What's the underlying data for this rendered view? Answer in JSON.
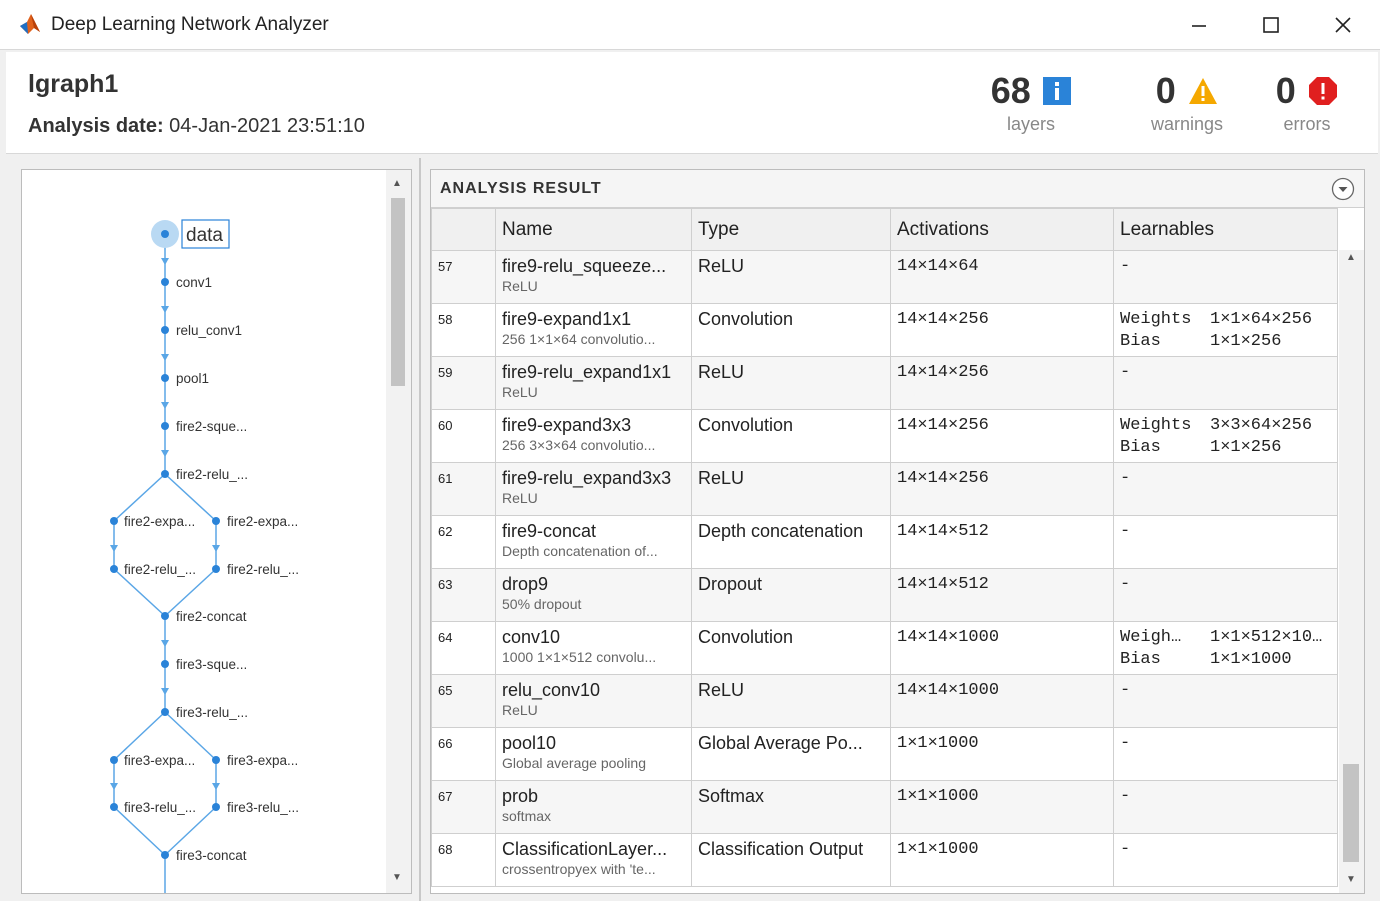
{
  "window": {
    "title": "Deep Learning Network Analyzer"
  },
  "header": {
    "graph_name": "lgraph1",
    "analysis_date_label": "Analysis date:",
    "analysis_date_value": "04-Jan-2021 23:51:10",
    "stats": {
      "layers": {
        "count": "68",
        "caption": "layers"
      },
      "warnings": {
        "count": "0",
        "caption": "warnings"
      },
      "errors": {
        "count": "0",
        "caption": "errors"
      }
    }
  },
  "colors": {
    "accent_blue": "#2a83d8",
    "edge_blue": "#5aa6e6",
    "warning": "#f5a800",
    "error": "#e01f1f"
  },
  "graph": {
    "nodes": [
      "data",
      "conv1",
      "relu_conv1",
      "pool1",
      "fire2-sque...",
      "fire2-relu_...",
      "fire2-expa...",
      "fire2-expa...",
      "fire2-relu_...",
      "fire2-relu_...",
      "fire2-concat",
      "fire3-sque...",
      "fire3-relu_...",
      "fire3-expa...",
      "fire3-expa...",
      "fire3-relu_...",
      "fire3-relu_...",
      "fire3-concat"
    ]
  },
  "results": {
    "title": "ANALYSIS RESULT",
    "columns": {
      "name": "Name",
      "type": "Type",
      "activations": "Activations",
      "learnables": "Learnables"
    },
    "rows": [
      {
        "idx": "57",
        "name": "fire9-relu_squeeze...",
        "sub": "ReLU",
        "type": "ReLU",
        "act": "14×14×64",
        "learn": [
          {
            "k": "-",
            "v": ""
          }
        ]
      },
      {
        "idx": "58",
        "name": "fire9-expand1x1",
        "sub": "256 1×1×64 convolutio...",
        "type": "Convolution",
        "act": "14×14×256",
        "learn": [
          {
            "k": "Weights",
            "v": "1×1×64×256"
          },
          {
            "k": "Bias",
            "v": "1×1×256"
          }
        ]
      },
      {
        "idx": "59",
        "name": "fire9-relu_expand1x1",
        "sub": "ReLU",
        "type": "ReLU",
        "act": "14×14×256",
        "learn": [
          {
            "k": "-",
            "v": ""
          }
        ]
      },
      {
        "idx": "60",
        "name": "fire9-expand3x3",
        "sub": "256 3×3×64 convolutio...",
        "type": "Convolution",
        "act": "14×14×256",
        "learn": [
          {
            "k": "Weights",
            "v": "3×3×64×256"
          },
          {
            "k": "Bias",
            "v": "1×1×256"
          }
        ]
      },
      {
        "idx": "61",
        "name": "fire9-relu_expand3x3",
        "sub": "ReLU",
        "type": "ReLU",
        "act": "14×14×256",
        "learn": [
          {
            "k": "-",
            "v": ""
          }
        ]
      },
      {
        "idx": "62",
        "name": "fire9-concat",
        "sub": "Depth concatenation of...",
        "type": "Depth concatenation",
        "act": "14×14×512",
        "learn": [
          {
            "k": "-",
            "v": ""
          }
        ]
      },
      {
        "idx": "63",
        "name": "drop9",
        "sub": "50% dropout",
        "type": "Dropout",
        "act": "14×14×512",
        "learn": [
          {
            "k": "-",
            "v": ""
          }
        ]
      },
      {
        "idx": "64",
        "name": "conv10",
        "sub": "1000 1×1×512 convolu...",
        "type": "Convolution",
        "act": "14×14×1000",
        "learn": [
          {
            "k": "Weigh…",
            "v": "1×1×512×10…"
          },
          {
            "k": "Bias",
            "v": "1×1×1000"
          }
        ]
      },
      {
        "idx": "65",
        "name": "relu_conv10",
        "sub": "ReLU",
        "type": "ReLU",
        "act": "14×14×1000",
        "learn": [
          {
            "k": "-",
            "v": ""
          }
        ]
      },
      {
        "idx": "66",
        "name": "pool10",
        "sub": "Global average pooling",
        "type": "Global Average Po...",
        "act": "1×1×1000",
        "learn": [
          {
            "k": "-",
            "v": ""
          }
        ]
      },
      {
        "idx": "67",
        "name": "prob",
        "sub": "softmax",
        "type": "Softmax",
        "act": "1×1×1000",
        "learn": [
          {
            "k": "-",
            "v": ""
          }
        ]
      },
      {
        "idx": "68",
        "name": "ClassificationLayer...",
        "sub": "crossentropyex with 'te...",
        "type": "Classification Output",
        "act": "1×1×1000",
        "learn": [
          {
            "k": "-",
            "v": ""
          }
        ]
      }
    ]
  }
}
